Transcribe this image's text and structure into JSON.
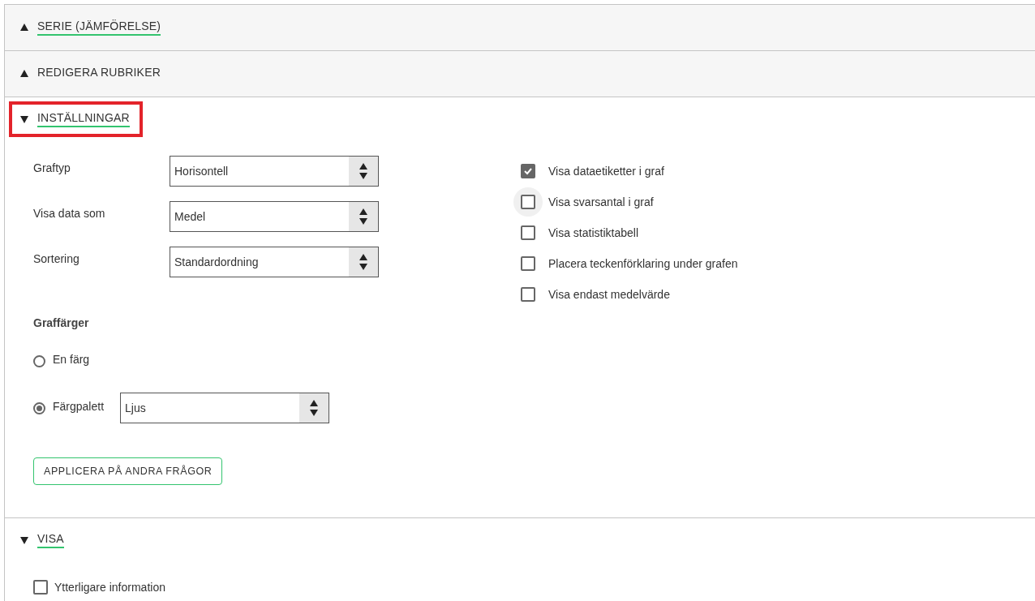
{
  "sections": [
    {
      "title": "SERIE (JÄMFÖRELSE)",
      "expanded": false,
      "underlined": true,
      "highlighted": false
    },
    {
      "title": "REDIGERA RUBRIKER",
      "expanded": false,
      "underlined": false,
      "highlighted": false
    },
    {
      "title": "INSTÄLLNINGAR",
      "expanded": true,
      "underlined": true,
      "highlighted": true,
      "kind": "settings"
    },
    {
      "title": "VISA",
      "expanded": true,
      "underlined": true,
      "highlighted": false,
      "kind": "visa"
    }
  ],
  "settings": {
    "selects": [
      {
        "label": "Graftyp",
        "value": "Horisontell"
      },
      {
        "label": "Visa data som",
        "value": "Medel"
      },
      {
        "label": "Sortering",
        "value": "Standardordning"
      }
    ],
    "graph_colors": {
      "title": "Graffärger",
      "options": [
        {
          "label": "En färg",
          "selected": false
        },
        {
          "label": "Färgpalett",
          "selected": true,
          "select_value": "Ljus"
        }
      ]
    },
    "apply_button": "APPLICERA PÅ ANDRA FRÅGOR",
    "checkboxes": [
      {
        "label": "Visa dataetiketter i graf",
        "checked": true,
        "hovered": false
      },
      {
        "label": "Visa svarsantal i graf",
        "checked": false,
        "hovered": true
      },
      {
        "label": "Visa statistiktabell",
        "checked": false,
        "hovered": false
      },
      {
        "label": "Placera teckenförklaring under grafen",
        "checked": false,
        "hovered": false
      },
      {
        "label": "Visa endast medelvärde",
        "checked": false,
        "hovered": false
      }
    ]
  },
  "visa": {
    "checkboxes": [
      {
        "label": "Ytterligare information",
        "checked": false
      }
    ]
  }
}
